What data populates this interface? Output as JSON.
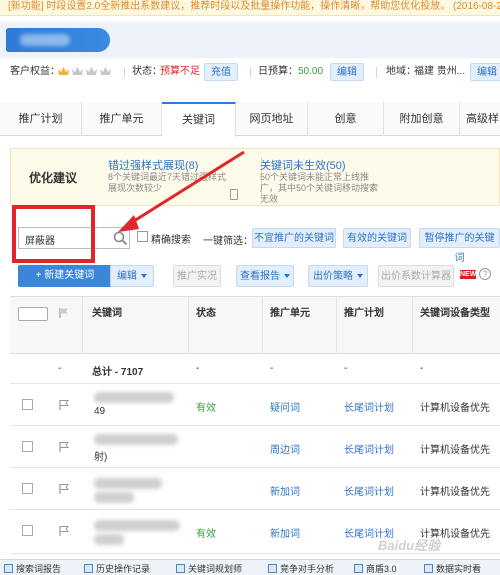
{
  "notice": "[新功能] 时段设置2.0全新推出系数建议，推荐时段以及批量操作功能，操作清晰，帮助您优化投放。 (2016-08-2",
  "info": {
    "customer_rights_label": "客户权益：",
    "status_label": "状态：",
    "status_value": "预算不足",
    "recharge_button": "充值",
    "daily_budget_label": "日预算：",
    "daily_budget_value": "50.00",
    "edit_button": "编辑",
    "region_label": "地域：",
    "region_value": "福建 贵州...",
    "region_edit_button": "编辑",
    "status_color": "#e0262a",
    "budget_color": "#3aa03a"
  },
  "tabs": [
    {
      "label": "推广计划"
    },
    {
      "label": "推广单元"
    },
    {
      "label": "关键词"
    },
    {
      "label": "网页地址"
    },
    {
      "label": "创意"
    },
    {
      "label": "附加创意"
    },
    {
      "label": "高级样"
    }
  ],
  "suggest": {
    "title": "优化建议",
    "item1_link": "错过强样式展现(8)",
    "item1_desc": "8个关键词最近7天错过强样式展现次数较少",
    "item2_link": "关键词未生效(50)",
    "item2_desc": "50个关键词未能正常上线推广，其中50个关键词移动搜索无效"
  },
  "search": {
    "value": "屏蔽器",
    "exact_label": "精确搜索",
    "filter_label": "一键筛选：",
    "filters": [
      "不宜推广的关键词",
      "有效的关键词",
      "暂停推广的关键词"
    ]
  },
  "toolbar": {
    "new_keyword": "+ 新建关键词",
    "edit": "编辑",
    "promo_status": "推广实况",
    "view_report": "查看报告",
    "bid_strategy": "出价策略",
    "bid_calc": "出价系数计算器",
    "new_badge": "NEW",
    "help": "?"
  },
  "table": {
    "headers": [
      "关键词",
      "状态",
      "推广单元",
      "推广计划",
      "关键词设备类型"
    ],
    "total_row": {
      "keyword": "总计 - 7107",
      "status": "-",
      "unit": "-",
      "plan": "-",
      "device": "-"
    },
    "rows": [
      {
        "keyword_tail": "49",
        "status": "有效",
        "unit": "疑问词",
        "plan": "长尾词计划",
        "device": "计算机设备优先"
      },
      {
        "keyword_tail": "射)",
        "status": "",
        "unit": "周边词",
        "plan": "长尾词计划",
        "device": "计算机设备优先"
      },
      {
        "keyword_tail": "",
        "status": "",
        "unit": "新加词",
        "plan": "长尾词计划",
        "device": "计算机设备优先"
      },
      {
        "keyword_tail": "",
        "status": "有效",
        "unit": "新加词",
        "plan": "长尾词计划",
        "device": "计算机设备优先"
      }
    ]
  },
  "bottom_bar": [
    "搜索词报告",
    "历史操作记录",
    "关键词规划师",
    "竞争对手分析",
    "商盾3.0",
    "数据实时看"
  ],
  "watermark": "Baidu经验"
}
